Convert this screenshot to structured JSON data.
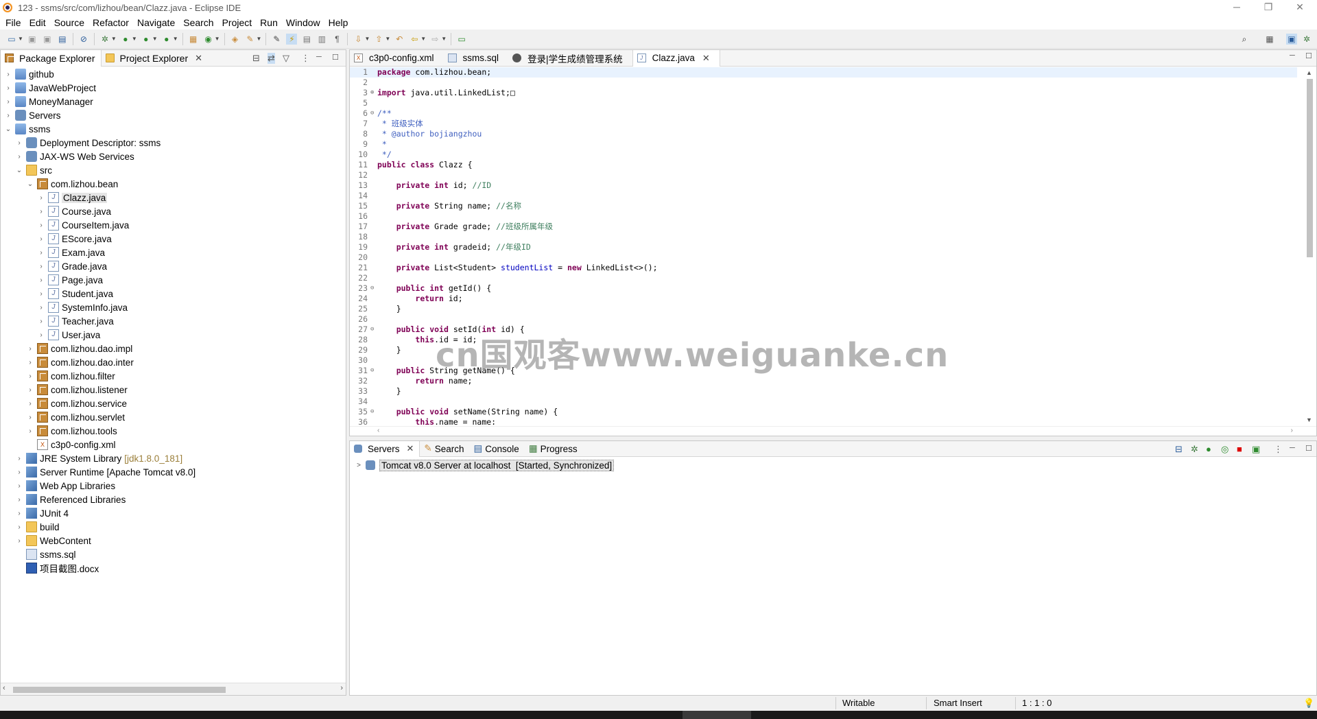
{
  "window": {
    "title": "123 - ssms/src/com/lizhou/bean/Clazz.java - Eclipse IDE",
    "min": "─",
    "max": "❐",
    "close": "✕"
  },
  "menu": [
    "File",
    "Edit",
    "Source",
    "Refactor",
    "Navigate",
    "Search",
    "Project",
    "Run",
    "Window",
    "Help"
  ],
  "left_panel": {
    "tabs": [
      {
        "label": "Package Explorer"
      },
      {
        "label": "Project Explorer"
      }
    ],
    "tree": [
      {
        "indent": 0,
        "tw": ">",
        "icon": "proj",
        "label": "github"
      },
      {
        "indent": 0,
        "tw": ">",
        "icon": "proj",
        "label": "JavaWebProject"
      },
      {
        "indent": 0,
        "tw": ">",
        "icon": "proj",
        "label": "MoneyManager"
      },
      {
        "indent": 0,
        "tw": ">",
        "icon": "srv",
        "label": "Servers"
      },
      {
        "indent": 0,
        "tw": "v",
        "icon": "proj",
        "label": "ssms"
      },
      {
        "indent": 1,
        "tw": ">",
        "icon": "srv",
        "label": "Deployment Descriptor: ssms"
      },
      {
        "indent": 1,
        "tw": ">",
        "icon": "srv",
        "label": "JAX-WS Web Services"
      },
      {
        "indent": 1,
        "tw": "v",
        "icon": "folder",
        "label": "src"
      },
      {
        "indent": 2,
        "tw": "v",
        "icon": "pkg",
        "label": "com.lizhou.bean"
      },
      {
        "indent": 3,
        "tw": ">",
        "icon": "java",
        "label": "Clazz.java",
        "selected": true
      },
      {
        "indent": 3,
        "tw": ">",
        "icon": "java",
        "label": "Course.java"
      },
      {
        "indent": 3,
        "tw": ">",
        "icon": "java",
        "label": "CourseItem.java"
      },
      {
        "indent": 3,
        "tw": ">",
        "icon": "java",
        "label": "EScore.java"
      },
      {
        "indent": 3,
        "tw": ">",
        "icon": "java",
        "label": "Exam.java"
      },
      {
        "indent": 3,
        "tw": ">",
        "icon": "java",
        "label": "Grade.java"
      },
      {
        "indent": 3,
        "tw": ">",
        "icon": "java",
        "label": "Page.java"
      },
      {
        "indent": 3,
        "tw": ">",
        "icon": "java",
        "label": "Student.java"
      },
      {
        "indent": 3,
        "tw": ">",
        "icon": "java",
        "label": "SystemInfo.java"
      },
      {
        "indent": 3,
        "tw": ">",
        "icon": "java",
        "label": "Teacher.java"
      },
      {
        "indent": 3,
        "tw": ">",
        "icon": "java",
        "label": "User.java"
      },
      {
        "indent": 2,
        "tw": ">",
        "icon": "pkg",
        "label": "com.lizhou.dao.impl"
      },
      {
        "indent": 2,
        "tw": ">",
        "icon": "pkg",
        "label": "com.lizhou.dao.inter"
      },
      {
        "indent": 2,
        "tw": ">",
        "icon": "pkg",
        "label": "com.lizhou.filter"
      },
      {
        "indent": 2,
        "tw": ">",
        "icon": "pkg",
        "label": "com.lizhou.listener"
      },
      {
        "indent": 2,
        "tw": ">",
        "icon": "pkg",
        "label": "com.lizhou.service"
      },
      {
        "indent": 2,
        "tw": ">",
        "icon": "pkg",
        "label": "com.lizhou.servlet"
      },
      {
        "indent": 2,
        "tw": ">",
        "icon": "pkg",
        "label": "com.lizhou.tools"
      },
      {
        "indent": 2,
        "tw": "",
        "icon": "xml",
        "label": "c3p0-config.xml"
      },
      {
        "indent": 1,
        "tw": ">",
        "icon": "lib",
        "label": "JRE System Library",
        "hint": "[jdk1.8.0_181]"
      },
      {
        "indent": 1,
        "tw": ">",
        "icon": "lib",
        "label": "Server Runtime [Apache Tomcat v8.0]"
      },
      {
        "indent": 1,
        "tw": ">",
        "icon": "lib",
        "label": "Web App Libraries"
      },
      {
        "indent": 1,
        "tw": ">",
        "icon": "lib",
        "label": "Referenced Libraries"
      },
      {
        "indent": 1,
        "tw": ">",
        "icon": "lib",
        "label": "JUnit 4"
      },
      {
        "indent": 1,
        "tw": ">",
        "icon": "folder",
        "label": "build"
      },
      {
        "indent": 1,
        "tw": ">",
        "icon": "folder",
        "label": "WebContent"
      },
      {
        "indent": 1,
        "tw": "",
        "icon": "sql",
        "label": "ssms.sql"
      },
      {
        "indent": 1,
        "tw": "",
        "icon": "doc",
        "label": "项目截图.docx"
      }
    ]
  },
  "editor": {
    "tabs": [
      {
        "label": "c3p0-config.xml",
        "icon": "xml"
      },
      {
        "label": "ssms.sql",
        "icon": "sql"
      },
      {
        "label": "登录|学生成绩管理系统",
        "icon": "web"
      },
      {
        "label": "Clazz.java",
        "icon": "java",
        "active": true
      }
    ],
    "lines": [
      {
        "n": "1",
        "fold": "",
        "t": "package com.lizhou.bean;"
      },
      {
        "n": "2",
        "fold": "",
        "t": ""
      },
      {
        "n": "3",
        "fold": "⊕",
        "t": "import java.util.LinkedList;□"
      },
      {
        "n": "5",
        "fold": "",
        "t": ""
      },
      {
        "n": "6",
        "fold": "⊖",
        "t": "/**"
      },
      {
        "n": "7",
        "fold": "",
        "t": " * 班级实体"
      },
      {
        "n": "8",
        "fold": "",
        "t": " * @author bojiangzhou"
      },
      {
        "n": "9",
        "fold": "",
        "t": " *"
      },
      {
        "n": "10",
        "fold": "",
        "t": " */"
      },
      {
        "n": "11",
        "fold": "",
        "t": "public class Clazz {"
      },
      {
        "n": "12",
        "fold": "",
        "t": ""
      },
      {
        "n": "13",
        "fold": "",
        "t": "    private int id; //ID"
      },
      {
        "n": "14",
        "fold": "",
        "t": ""
      },
      {
        "n": "15",
        "fold": "",
        "t": "    private String name; //名称"
      },
      {
        "n": "16",
        "fold": "",
        "t": ""
      },
      {
        "n": "17",
        "fold": "",
        "t": "    private Grade grade; //班级所属年级"
      },
      {
        "n": "18",
        "fold": "",
        "t": ""
      },
      {
        "n": "19",
        "fold": "",
        "t": "    private int gradeid; //年级ID"
      },
      {
        "n": "20",
        "fold": "",
        "t": ""
      },
      {
        "n": "21",
        "fold": "",
        "t": "    private List<Student> studentList = new LinkedList<>();"
      },
      {
        "n": "22",
        "fold": "",
        "t": ""
      },
      {
        "n": "23",
        "fold": "⊖",
        "t": "    public int getId() {"
      },
      {
        "n": "24",
        "fold": "",
        "t": "        return id;"
      },
      {
        "n": "25",
        "fold": "",
        "t": "    }"
      },
      {
        "n": "26",
        "fold": "",
        "t": ""
      },
      {
        "n": "27",
        "fold": "⊖",
        "t": "    public void setId(int id) {"
      },
      {
        "n": "28",
        "fold": "",
        "t": "        this.id = id;"
      },
      {
        "n": "29",
        "fold": "",
        "t": "    }"
      },
      {
        "n": "30",
        "fold": "",
        "t": ""
      },
      {
        "n": "31",
        "fold": "⊖",
        "t": "    public String getName() {"
      },
      {
        "n": "32",
        "fold": "",
        "t": "        return name;"
      },
      {
        "n": "33",
        "fold": "",
        "t": "    }"
      },
      {
        "n": "34",
        "fold": "",
        "t": ""
      },
      {
        "n": "35",
        "fold": "⊖",
        "t": "    public void setName(String name) {"
      },
      {
        "n": "36",
        "fold": "",
        "t": "        this.name = name;"
      }
    ]
  },
  "bottom_panel": {
    "tabs": [
      {
        "label": "Servers",
        "active": true
      },
      {
        "label": "Search"
      },
      {
        "label": "Console"
      },
      {
        "label": "Progress"
      }
    ],
    "server": {
      "name": "Tomcat v8.0 Server at localhost",
      "state": "[Started, Synchronized]"
    }
  },
  "status": {
    "writable": "Writable",
    "insert": "Smart Insert",
    "position": "1 : 1 : 0"
  },
  "watermark": "cn国观客www.weiguanke.cn",
  "colors": {
    "keyword": "#7f0055",
    "comment": "#3f7f5f",
    "javadoc": "#3f5fbf",
    "field": "#0000c0"
  }
}
